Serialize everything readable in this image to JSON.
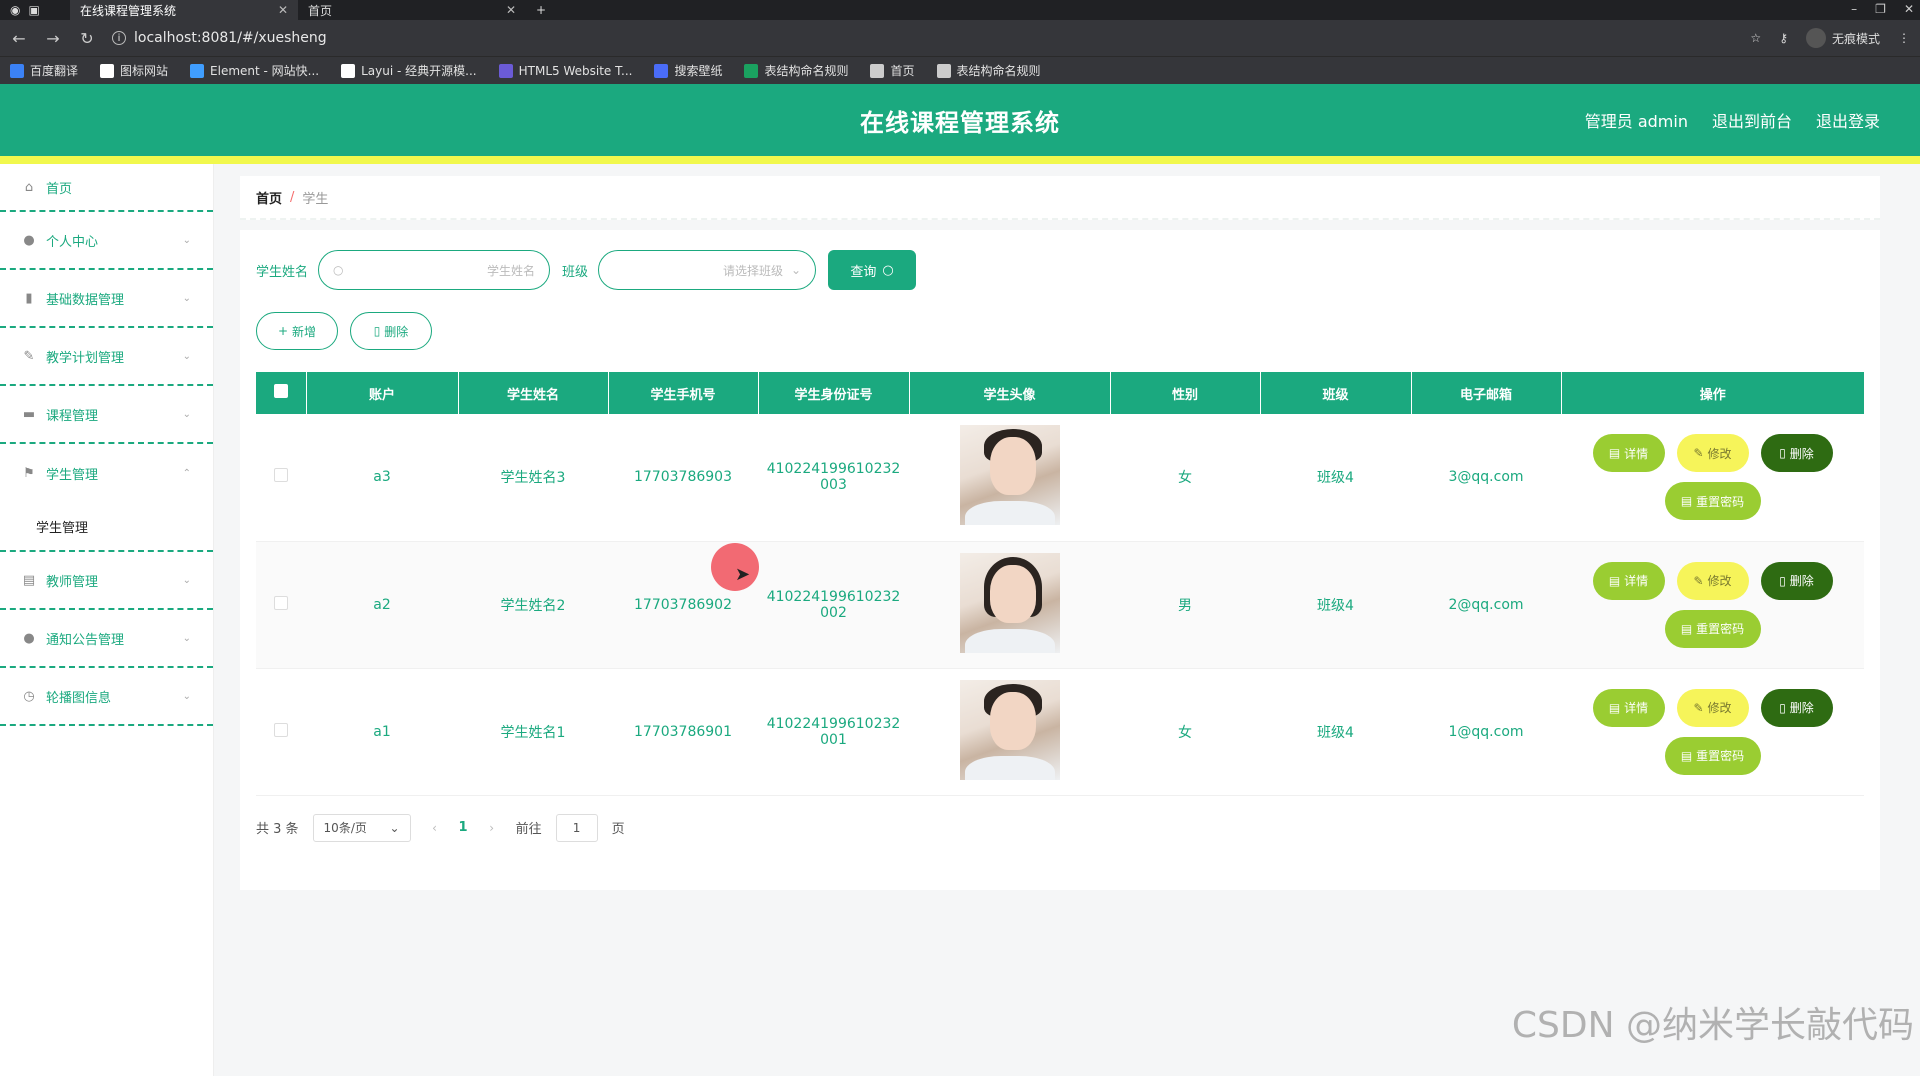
{
  "browser": {
    "tabs": [
      {
        "title": "在线课程管理系统",
        "active": true
      },
      {
        "title": "首页",
        "active": false
      }
    ],
    "url": "localhost:8081/#/xuesheng",
    "incognito_label": "无痕模式",
    "bookmarks": [
      {
        "label": "百度翻译",
        "icon": "translate-icon",
        "color": "#3b82f6"
      },
      {
        "label": "图标网站",
        "icon": "flag-icon",
        "color": "#ffffff"
      },
      {
        "label": "Element - 网站快...",
        "icon": "element-icon",
        "color": "#409eff"
      },
      {
        "label": "Layui - 经典开源模...",
        "icon": "layui-icon",
        "color": "#ffffff"
      },
      {
        "label": "HTML5 Website T...",
        "icon": "html5-icon",
        "color": "#6b5bd6"
      },
      {
        "label": "搜索壁纸",
        "icon": "wallpaper-icon",
        "color": "#4a6cf7"
      },
      {
        "label": "表结构命名规则",
        "icon": "sheet-icon",
        "color": "#1aa260"
      },
      {
        "label": "首页",
        "icon": "globe-icon",
        "color": "#cccccc"
      },
      {
        "label": "表结构命名规则",
        "icon": "globe-icon",
        "color": "#cccccc"
      }
    ]
  },
  "header": {
    "title": "在线课程管理系统",
    "admin_label": "管理员 admin",
    "frontend_label": "退出到前台",
    "logout_label": "退出登录",
    "accent": "#1ba97f",
    "stripe": "#f1f84d"
  },
  "sidebar": {
    "items": [
      {
        "label": "首页",
        "icon": "home-icon"
      },
      {
        "label": "个人中心",
        "icon": "user-icon"
      },
      {
        "label": "基础数据管理",
        "icon": "bar-chart-icon"
      },
      {
        "label": "教学计划管理",
        "icon": "plan-icon"
      },
      {
        "label": "课程管理",
        "icon": "briefcase-icon"
      },
      {
        "label": "学生管理",
        "icon": "flag-icon",
        "submenu": [
          "学生管理"
        ]
      },
      {
        "label": "教师管理",
        "icon": "clipboard-icon"
      },
      {
        "label": "通知公告管理",
        "icon": "user-icon"
      },
      {
        "label": "轮播图信息",
        "icon": "clock-icon"
      }
    ]
  },
  "breadcrumb": {
    "home": "首页",
    "separator": "/",
    "current": "学生"
  },
  "search": {
    "name_label": "学生姓名",
    "name_placeholder": "学生姓名",
    "class_label": "班级",
    "class_placeholder": "请选择班级",
    "query_label": "查询"
  },
  "actions": {
    "add_label": "新增",
    "delete_label": "删除"
  },
  "table": {
    "columns": [
      "账户",
      "学生姓名",
      "学生手机号",
      "学生身份证号",
      "学生头像",
      "性别",
      "班级",
      "电子邮箱",
      "操作"
    ],
    "rows": [
      {
        "account": "a3",
        "name": "学生姓名3",
        "phone": "17703786903",
        "id_line1": "410224199610232",
        "id_line2": "003",
        "gender": "女",
        "class": "班级4",
        "email": "3@qq.com"
      },
      {
        "account": "a2",
        "name": "学生姓名2",
        "phone": "17703786902",
        "id_line1": "410224199610232",
        "id_line2": "002",
        "gender": "男",
        "class": "班级4",
        "email": "2@qq.com"
      },
      {
        "account": "a1",
        "name": "学生姓名1",
        "phone": "17703786901",
        "id_line1": "410224199610232",
        "id_line2": "001",
        "gender": "女",
        "class": "班级4",
        "email": "1@qq.com"
      }
    ],
    "op_labels": {
      "detail": "详情",
      "edit": "修改",
      "delete": "删除",
      "reset": "重置密码"
    }
  },
  "pagination": {
    "total_label": "共 3 条",
    "page_size": "10条/页",
    "current_page": "1",
    "goto_label": "前往",
    "goto_value": "1",
    "page_unit": "页"
  },
  "watermark": "CSDN @纳米学长敲代码"
}
